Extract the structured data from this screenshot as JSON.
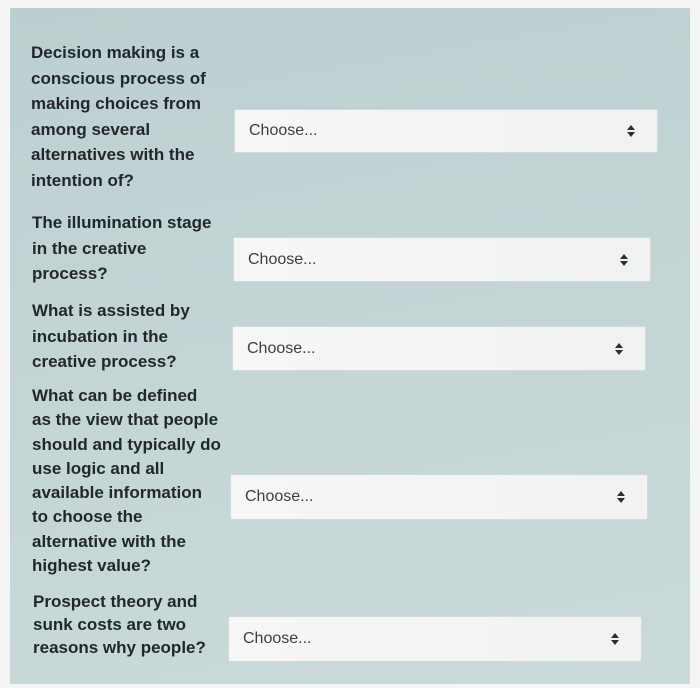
{
  "questions": [
    {
      "text": "Decision making is a\nconscious process of\nmaking choices from\namong several\nalternatives with the\nintention of?",
      "selected": "Choose..."
    },
    {
      "text": "The illumination stage\nin the creative\nprocess?",
      "selected": "Choose..."
    },
    {
      "text": "What is assisted by\nincubation in the\ncreative process?",
      "selected": "Choose..."
    },
    {
      "text": "What can be defined\nas the view that people\nshould and typically do\nuse logic and all\navailable information\nto choose the\nalternative with the\nhighest value?",
      "selected": "Choose..."
    },
    {
      "text": "Prospect theory and\nsunk costs are two\nreasons why people?",
      "selected": "Choose..."
    }
  ],
  "colors": {
    "panel_bg": "#c3d4d5",
    "question_text": "#22272b",
    "select_bg": "#f4f4f4",
    "select_text": "#3a3f44"
  },
  "icons": {
    "dropdown": "updown-arrows-icon"
  }
}
